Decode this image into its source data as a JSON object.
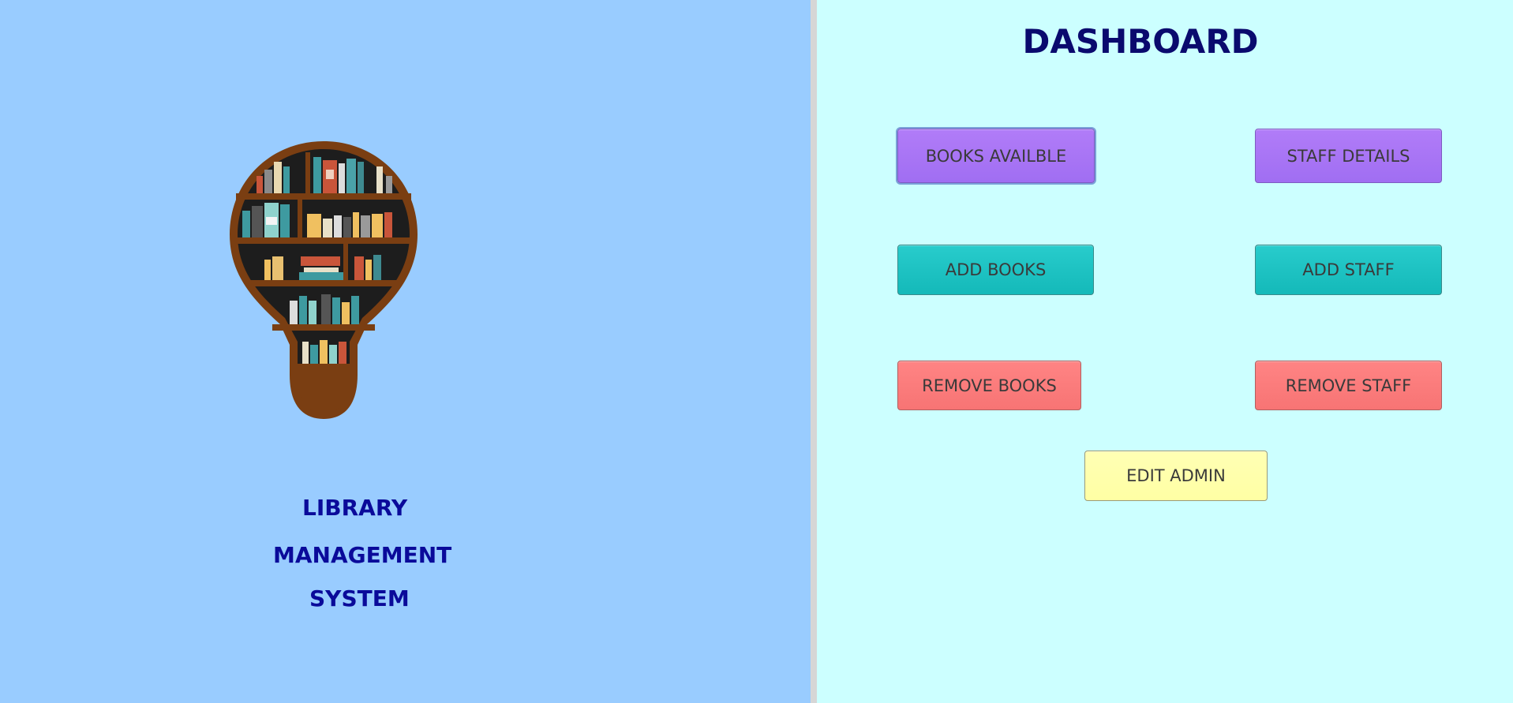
{
  "app": {
    "name_lines": [
      "LIBRARY",
      "MANAGEMENT",
      "SYSTEM"
    ],
    "logo_icon": "bookshelf-lightbulb-icon"
  },
  "dashboard": {
    "title": "DASHBOARD",
    "buttons": {
      "books_available": "BOOKS AVAILBLE",
      "staff_details": "STAFF DETAILS",
      "add_books": "ADD BOOKS",
      "add_staff": "ADD STAFF",
      "remove_books": "REMOVE BOOKS",
      "remove_staff": "REMOVE STAFF",
      "edit_admin": "EDIT ADMIN"
    }
  },
  "colors": {
    "left_panel_bg": "#99ccff",
    "right_panel_bg": "#ccffff",
    "title_text": "#0a0a6e",
    "app_name_text": "#0a0a9a",
    "purple_button": "#a679f6",
    "teal_button": "#1ec3c3",
    "red_button": "#fb7b7b",
    "yellow_button": "#ffffaa"
  }
}
